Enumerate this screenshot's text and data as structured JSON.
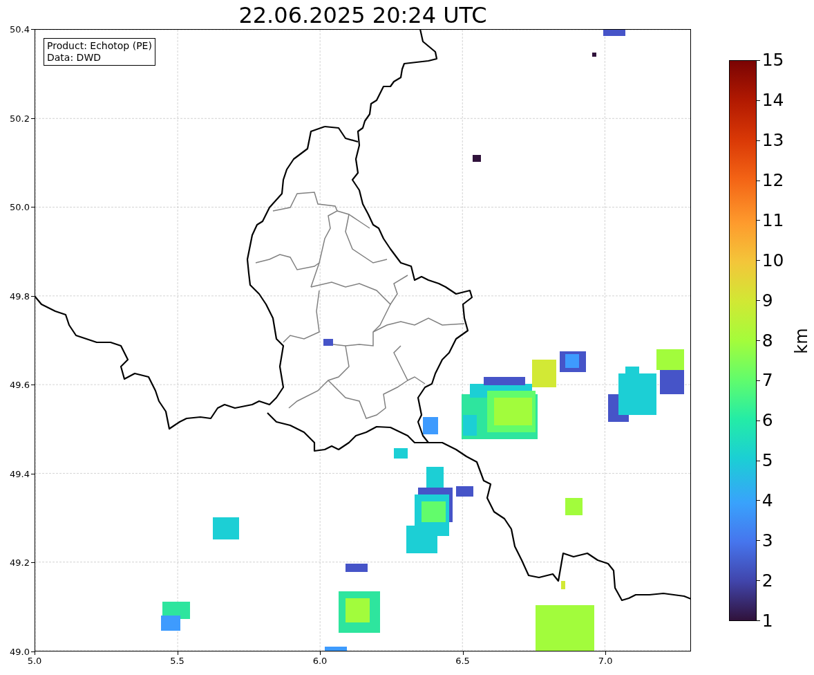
{
  "title": "22.06.2025 20:24 UTC",
  "info_box": {
    "lines": [
      "Product: Echotop (PE)",
      "Data: DWD"
    ]
  },
  "x_axis": {
    "ticks": [
      "5.0",
      "5.5",
      "6.0",
      "6.5",
      "7.0"
    ]
  },
  "y_axis": {
    "ticks": [
      "50.4",
      "50.2",
      "50.0",
      "49.8",
      "49.6",
      "49.4",
      "49.2",
      "49.0"
    ]
  },
  "colorbar": {
    "label": "km",
    "ticks": [
      "15",
      "14",
      "13",
      "12",
      "11",
      "10",
      "9",
      "8",
      "7",
      "6",
      "5",
      "4",
      "3",
      "2",
      "1"
    ]
  }
}
